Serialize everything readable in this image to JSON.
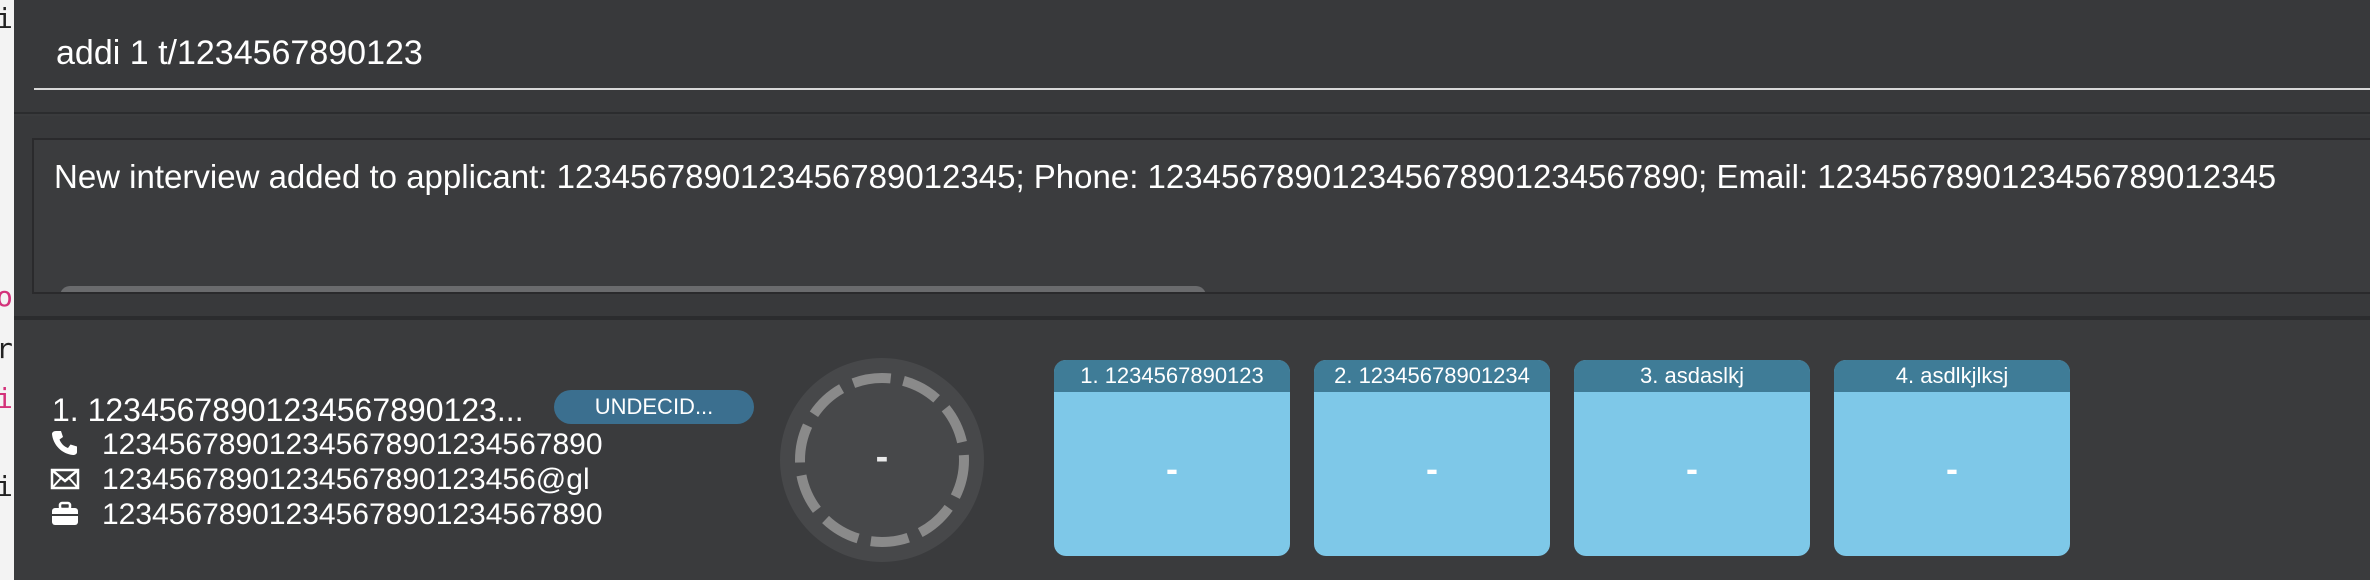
{
  "left_strip": {
    "glyphs": [
      "i",
      "o",
      "r",
      "i",
      "i"
    ]
  },
  "command_box": {
    "value": "addi 1 t/1234567890123"
  },
  "result_display": {
    "text": "New interview added to applicant: 1234567890123456789012345; Phone: 12345678901234567890123456789​0; Email: 1234567890123456789012345"
  },
  "applicant_card": {
    "name": "1.  1234567890123456789​0123...",
    "status": "UNDECID...",
    "phone": "12345678901234567890​1234567890",
    "email": "12345678901234567890123456@gl",
    "job": "123456789012345678901234567890",
    "overall_score": "-",
    "icons": [
      "phone-icon",
      "email-icon",
      "briefcase-icon"
    ]
  },
  "interview_rounds": [
    {
      "header": "1. 1234567890123",
      "score": "-"
    },
    {
      "header": "2. 12345678901234",
      "score": "-"
    },
    {
      "header": "3. asdaslkj",
      "score": "-"
    },
    {
      "header": "4. asdlkjlksj",
      "score": "-"
    }
  ],
  "colors": {
    "background": "#38393b",
    "badge": "#3b6f8f",
    "round_box": "#7ec8e8",
    "round_header": "#3f7c97"
  }
}
